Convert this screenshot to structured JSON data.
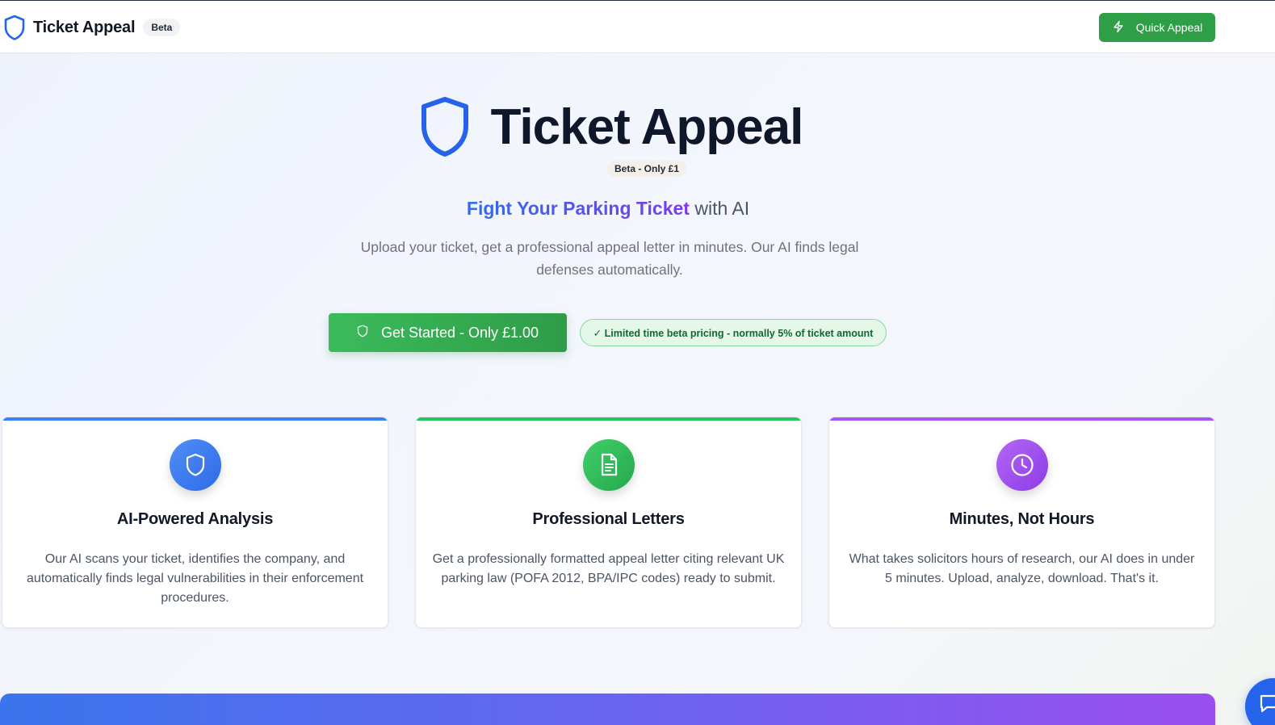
{
  "header": {
    "brand_name": "Ticket Appeal",
    "beta_badge": "Beta",
    "quick_appeal_label": "Quick Appeal"
  },
  "hero": {
    "title": "Ticket Appeal",
    "pill": "Beta - Only £1",
    "tagline_highlight": "Fight Your Parking Ticket",
    "tagline_rest": " with AI",
    "subtitle": "Upload your ticket, get a professional appeal letter in minutes. Our AI finds legal defenses automatically.",
    "cta_label": "Get Started - Only £1.00",
    "beta_note": "✓ Limited time beta pricing - normally 5% of ticket amount"
  },
  "features": [
    {
      "title": "AI-Powered Analysis",
      "text": "Our AI scans your ticket, identifies the company, and automatically finds legal vulnerabilities in their enforcement procedures.",
      "icon": "shield-icon",
      "accent": "#3b82f6"
    },
    {
      "title": "Professional Letters",
      "text": "Get a professionally formatted appeal letter citing relevant UK parking law (POFA 2012, BPA/IPC codes) ready to submit.",
      "icon": "document-icon",
      "accent": "#22c55e"
    },
    {
      "title": "Minutes, Not Hours",
      "text": "What takes solicitors hours of research, our AI does in under 5 minutes. Upload, analyze, download. That's it.",
      "icon": "clock-icon",
      "accent": "#a855f7"
    }
  ],
  "colors": {
    "primary_green": "#2e9e47",
    "brand_blue": "#2563eb",
    "purple": "#9333ea"
  }
}
